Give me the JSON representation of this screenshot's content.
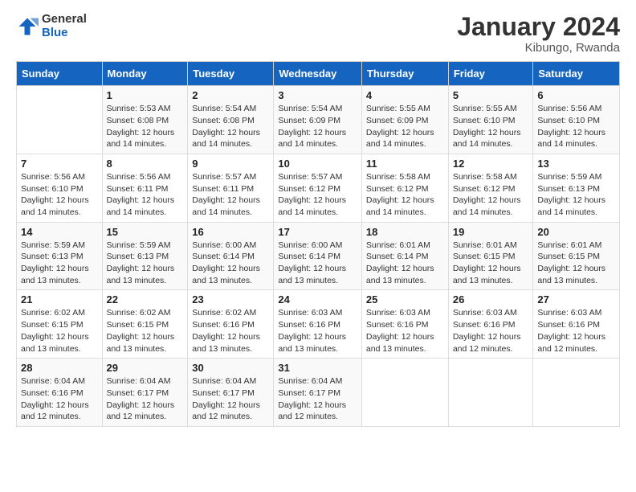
{
  "logo": {
    "general": "General",
    "blue": "Blue"
  },
  "title": "January 2024",
  "subtitle": "Kibungo, Rwanda",
  "header_days": [
    "Sunday",
    "Monday",
    "Tuesday",
    "Wednesday",
    "Thursday",
    "Friday",
    "Saturday"
  ],
  "weeks": [
    [
      {
        "day": "",
        "info": ""
      },
      {
        "day": "1",
        "info": "Sunrise: 5:53 AM\nSunset: 6:08 PM\nDaylight: 12 hours and 14 minutes."
      },
      {
        "day": "2",
        "info": "Sunrise: 5:54 AM\nSunset: 6:08 PM\nDaylight: 12 hours and 14 minutes."
      },
      {
        "day": "3",
        "info": "Sunrise: 5:54 AM\nSunset: 6:09 PM\nDaylight: 12 hours and 14 minutes."
      },
      {
        "day": "4",
        "info": "Sunrise: 5:55 AM\nSunset: 6:09 PM\nDaylight: 12 hours and 14 minutes."
      },
      {
        "day": "5",
        "info": "Sunrise: 5:55 AM\nSunset: 6:10 PM\nDaylight: 12 hours and 14 minutes."
      },
      {
        "day": "6",
        "info": "Sunrise: 5:56 AM\nSunset: 6:10 PM\nDaylight: 12 hours and 14 minutes."
      }
    ],
    [
      {
        "day": "7",
        "info": "Sunrise: 5:56 AM\nSunset: 6:10 PM\nDaylight: 12 hours and 14 minutes."
      },
      {
        "day": "8",
        "info": "Sunrise: 5:56 AM\nSunset: 6:11 PM\nDaylight: 12 hours and 14 minutes."
      },
      {
        "day": "9",
        "info": "Sunrise: 5:57 AM\nSunset: 6:11 PM\nDaylight: 12 hours and 14 minutes."
      },
      {
        "day": "10",
        "info": "Sunrise: 5:57 AM\nSunset: 6:12 PM\nDaylight: 12 hours and 14 minutes."
      },
      {
        "day": "11",
        "info": "Sunrise: 5:58 AM\nSunset: 6:12 PM\nDaylight: 12 hours and 14 minutes."
      },
      {
        "day": "12",
        "info": "Sunrise: 5:58 AM\nSunset: 6:12 PM\nDaylight: 12 hours and 14 minutes."
      },
      {
        "day": "13",
        "info": "Sunrise: 5:59 AM\nSunset: 6:13 PM\nDaylight: 12 hours and 14 minutes."
      }
    ],
    [
      {
        "day": "14",
        "info": "Sunrise: 5:59 AM\nSunset: 6:13 PM\nDaylight: 12 hours and 13 minutes."
      },
      {
        "day": "15",
        "info": "Sunrise: 5:59 AM\nSunset: 6:13 PM\nDaylight: 12 hours and 13 minutes."
      },
      {
        "day": "16",
        "info": "Sunrise: 6:00 AM\nSunset: 6:14 PM\nDaylight: 12 hours and 13 minutes."
      },
      {
        "day": "17",
        "info": "Sunrise: 6:00 AM\nSunset: 6:14 PM\nDaylight: 12 hours and 13 minutes."
      },
      {
        "day": "18",
        "info": "Sunrise: 6:01 AM\nSunset: 6:14 PM\nDaylight: 12 hours and 13 minutes."
      },
      {
        "day": "19",
        "info": "Sunrise: 6:01 AM\nSunset: 6:15 PM\nDaylight: 12 hours and 13 minutes."
      },
      {
        "day": "20",
        "info": "Sunrise: 6:01 AM\nSunset: 6:15 PM\nDaylight: 12 hours and 13 minutes."
      }
    ],
    [
      {
        "day": "21",
        "info": "Sunrise: 6:02 AM\nSunset: 6:15 PM\nDaylight: 12 hours and 13 minutes."
      },
      {
        "day": "22",
        "info": "Sunrise: 6:02 AM\nSunset: 6:15 PM\nDaylight: 12 hours and 13 minutes."
      },
      {
        "day": "23",
        "info": "Sunrise: 6:02 AM\nSunset: 6:16 PM\nDaylight: 12 hours and 13 minutes."
      },
      {
        "day": "24",
        "info": "Sunrise: 6:03 AM\nSunset: 6:16 PM\nDaylight: 12 hours and 13 minutes."
      },
      {
        "day": "25",
        "info": "Sunrise: 6:03 AM\nSunset: 6:16 PM\nDaylight: 12 hours and 13 minutes."
      },
      {
        "day": "26",
        "info": "Sunrise: 6:03 AM\nSunset: 6:16 PM\nDaylight: 12 hours and 12 minutes."
      },
      {
        "day": "27",
        "info": "Sunrise: 6:03 AM\nSunset: 6:16 PM\nDaylight: 12 hours and 12 minutes."
      }
    ],
    [
      {
        "day": "28",
        "info": "Sunrise: 6:04 AM\nSunset: 6:16 PM\nDaylight: 12 hours and 12 minutes."
      },
      {
        "day": "29",
        "info": "Sunrise: 6:04 AM\nSunset: 6:17 PM\nDaylight: 12 hours and 12 minutes."
      },
      {
        "day": "30",
        "info": "Sunrise: 6:04 AM\nSunset: 6:17 PM\nDaylight: 12 hours and 12 minutes."
      },
      {
        "day": "31",
        "info": "Sunrise: 6:04 AM\nSunset: 6:17 PM\nDaylight: 12 hours and 12 minutes."
      },
      {
        "day": "",
        "info": ""
      },
      {
        "day": "",
        "info": ""
      },
      {
        "day": "",
        "info": ""
      }
    ]
  ]
}
